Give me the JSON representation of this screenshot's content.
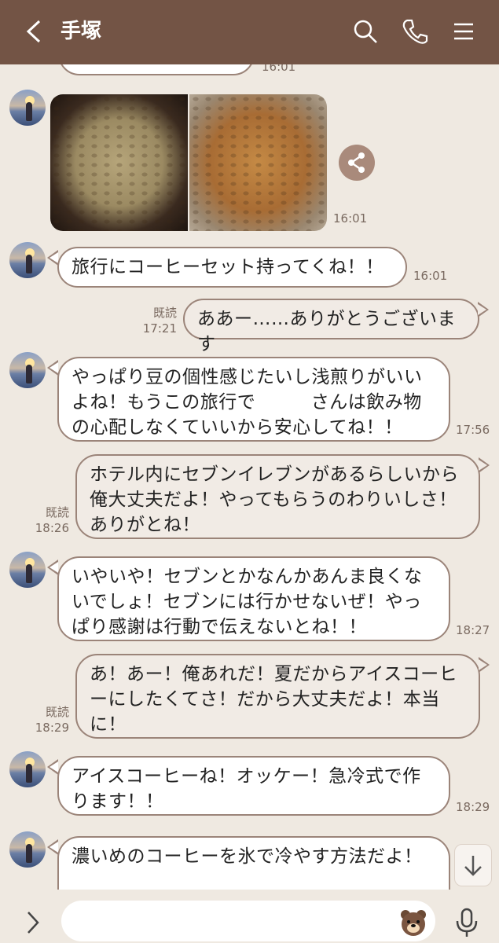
{
  "header": {
    "title": "手塚",
    "back_icon": "chevron-left-icon",
    "search_icon": "search-icon",
    "call_icon": "phone-icon",
    "menu_icon": "menu-icon",
    "bg_color": "#735445"
  },
  "messages": {
    "top_time": "16:01",
    "photo_time": "16:01",
    "m1": {
      "text": "旅行にコーヒーセット持ってくね！！",
      "time": "16:01"
    },
    "m2": {
      "text": "ああー……ありがとうございます",
      "read": "既読",
      "time": "17:21"
    },
    "m3": {
      "text": "やっぱり豆の個性感じたいし浅煎りがいいよね！もうこの旅行で　　　さんは飲み物の心配しなくていいから安心してね！！",
      "time": "17:56"
    },
    "m4": {
      "text": "ホテル内にセブンイレブンがあるらしいから俺大丈夫だよ！やってもらうのわりいしさ！ありがとね！",
      "read": "既読",
      "time": "18:26"
    },
    "m5": {
      "text": "いやいや！セブンとかなんかあんま良くないでしょ！セブンには行かせないぜ！やっぱり感謝は行動で伝えないとね！！",
      "time": "18:27"
    },
    "m6": {
      "text": "あ！あー！俺あれだ！夏だからアイスコーヒーにしたくてさ！だから大丈夫だよ！本当に！",
      "read": "既読",
      "time": "18:29"
    },
    "m7": {
      "text": "アイスコーヒーね！オッケー！急冷式で作ります！！",
      "time": "18:29"
    },
    "m8": {
      "text": "濃いめのコーヒーを氷で冷やす方法だよ！"
    }
  },
  "input": {
    "expand_icon": "chevron-right-icon",
    "sticker_icon": "bear-sticker-icon",
    "mic_icon": "microphone-icon",
    "scroll_icon": "arrow-down-icon"
  },
  "colors": {
    "accent": "#735445",
    "bubble_border": "#9b8479",
    "background": "#efe9e1"
  }
}
